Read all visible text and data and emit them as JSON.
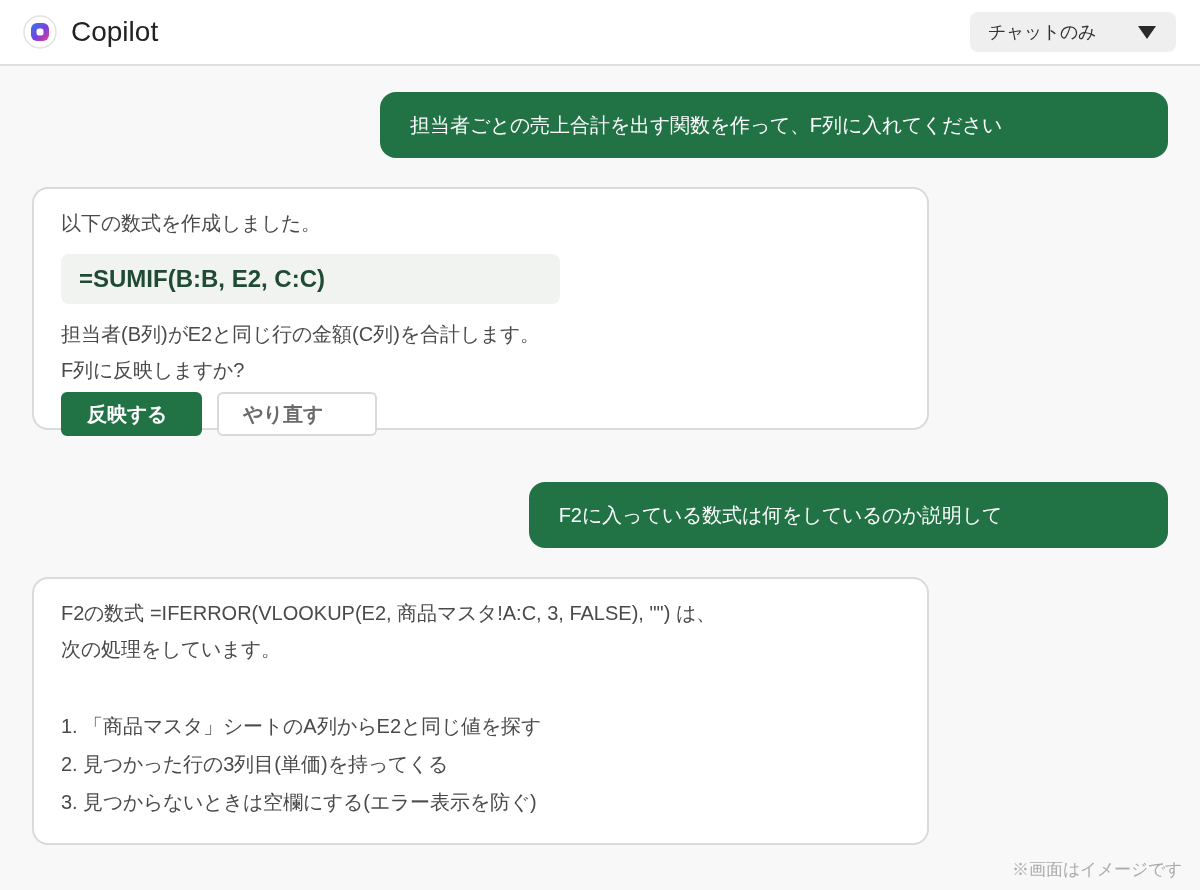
{
  "app": {
    "title": "Copilot"
  },
  "mode_select": {
    "value": "チャットのみ"
  },
  "messages": [
    {
      "kind": "user",
      "text": "担当者ごとの売上合計を出す関数を作って、F列に入れてください"
    },
    {
      "kind": "assistant",
      "blocks": [
        {
          "kind": "text",
          "lines": [
            "以下の数式を作成しました。"
          ]
        },
        {
          "kind": "code",
          "text": "=SUMIF(B:B, E2, C:C)"
        },
        {
          "kind": "text",
          "lines": [
            "担当者(B列)がE2と同じ行の金額(C列)を合計します。",
            "F列に反映しますか?"
          ]
        },
        {
          "kind": "actions",
          "buttons": [
            {
              "label": "反映する",
              "kind": "primary"
            },
            {
              "label": "やり直す",
              "kind": "secondary"
            }
          ]
        }
      ]
    },
    {
      "kind": "user",
      "text": "F2に入っている数式は何をしているのか説明して"
    },
    {
      "kind": "assistant",
      "blocks": [
        {
          "kind": "text",
          "lines": [
            "F2の数式 =IFERROR(VLOOKUP(E2, 商品マスタ!A:C, 3, FALSE), \"\") は、",
            "次の処理をしています。"
          ]
        },
        {
          "kind": "list",
          "items": [
            "1. 「商品マスタ」シートのA列からE2と同じ値を探す",
            "2. 見つかった行の3列目(単価)を持ってくる",
            "3. 見つからないときは空欄にする(エラー表示を防ぐ)"
          ]
        }
      ]
    }
  ],
  "footer_note": "※画面はイメージです"
}
